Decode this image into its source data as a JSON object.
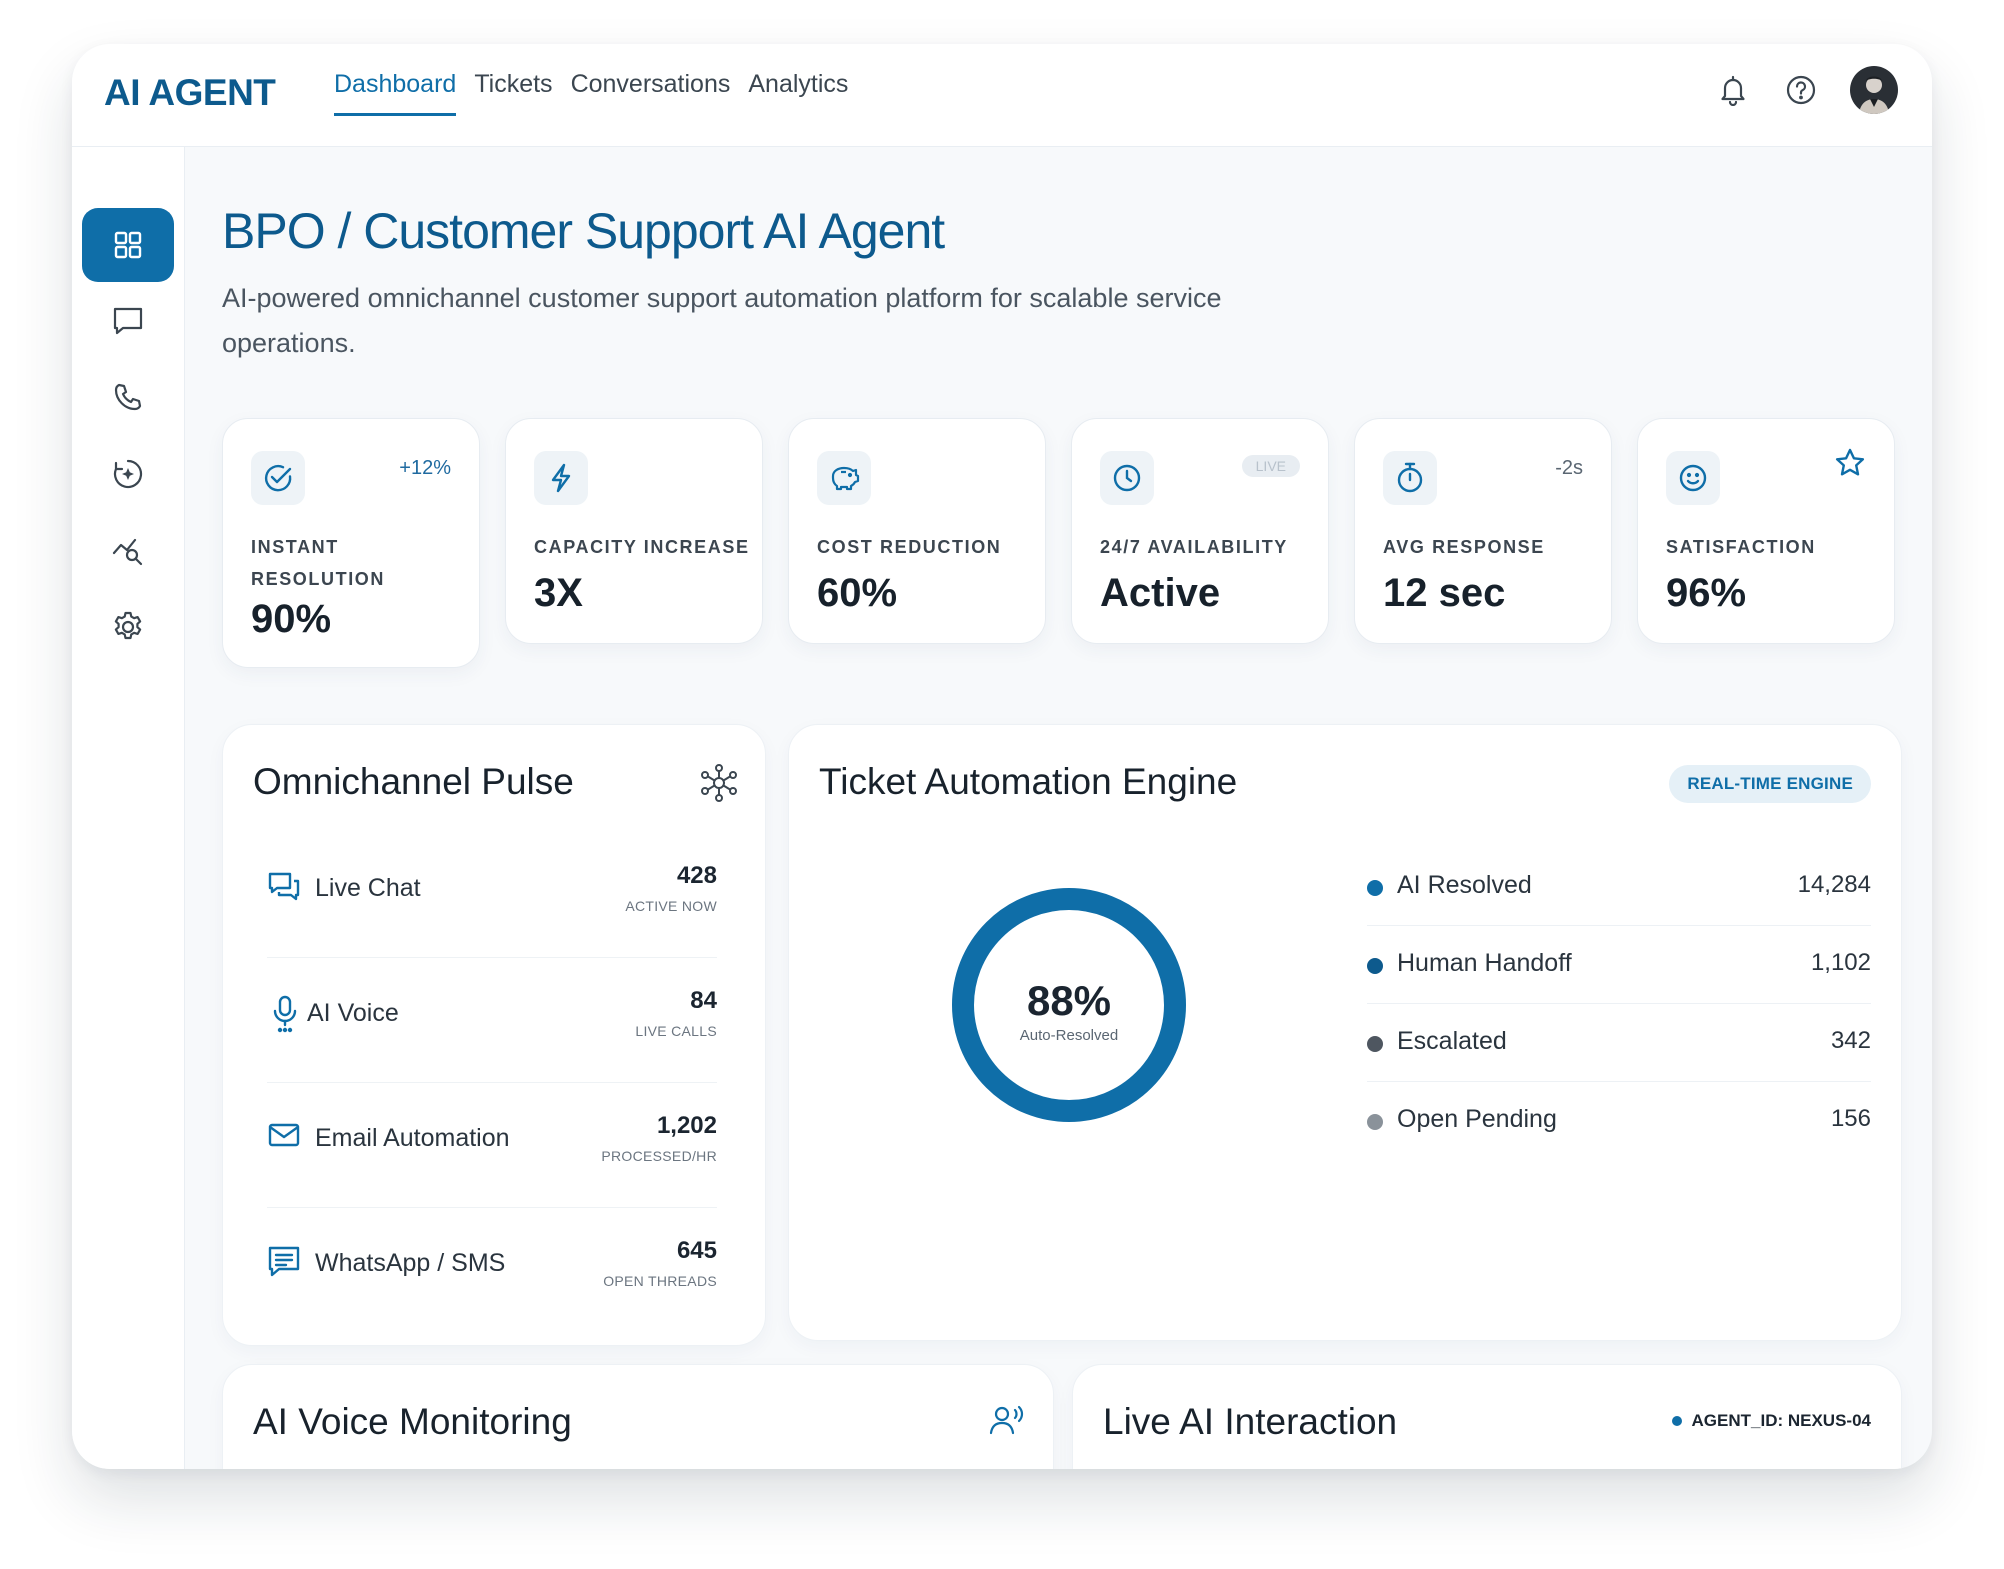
{
  "app": {
    "logo": "AI AGENT"
  },
  "nav": [
    "Dashboard",
    "Tickets",
    "Conversations",
    "Analytics"
  ],
  "nav_active": "Dashboard",
  "header": {
    "title": "BPO / Customer Support AI Agent",
    "subtitle": "AI-powered omnichannel customer support automation platform for scalable service operations."
  },
  "kpis": [
    {
      "label": "INSTANT RESOLUTION",
      "value": "90%",
      "badge": "+12%",
      "icon": "check-circle-icon"
    },
    {
      "label": "CAPACITY INCREASE",
      "value": "3X",
      "badge": "",
      "icon": "lightning-icon"
    },
    {
      "label": "COST REDUCTION",
      "value": "60%",
      "badge": "",
      "icon": "piggy-bank-icon"
    },
    {
      "label": "24/7 AVAILABILITY",
      "value": "Active",
      "badge": "LIVE",
      "icon": "clock-icon"
    },
    {
      "label": "AVG RESPONSE",
      "value": "12 sec",
      "badge": "-2s",
      "icon": "stopwatch-icon"
    },
    {
      "label": "SATISFACTION",
      "value": "96%",
      "badge": "",
      "icon": "smile-icon"
    }
  ],
  "pulse": {
    "title": "Omnichannel Pulse",
    "rows": [
      {
        "label": "Live Chat",
        "value": "428",
        "sub": "ACTIVE NOW",
        "icon": "chat-icon"
      },
      {
        "label": "AI Voice",
        "value": "84",
        "sub": "LIVE CALLS",
        "icon": "microphone-icon"
      },
      {
        "label": "Email Automation",
        "value": "1,202",
        "sub": "PROCESSED/HR",
        "icon": "mail-icon"
      },
      {
        "label": "WhatsApp / SMS",
        "value": "645",
        "sub": "OPEN THREADS",
        "icon": "message-icon"
      }
    ]
  },
  "engine": {
    "title": "Ticket Automation Engine",
    "badge": "REAL-TIME ENGINE",
    "donut_value": "88%",
    "donut_fraction": 1.0,
    "donut_label": "Auto-Resolved",
    "legend": [
      {
        "label": "AI Resolved",
        "value": "14,284",
        "color": "#0f6ea8"
      },
      {
        "label": "Human Handoff",
        "value": "1,102",
        "color": "#0d5a8d"
      },
      {
        "label": "Escalated",
        "value": "342",
        "color": "#4e5660"
      },
      {
        "label": "Open Pending",
        "value": "156",
        "color": "#8a929a"
      }
    ]
  },
  "voice": {
    "title": "AI Voice Monitoring"
  },
  "interaction": {
    "title": "Live AI Interaction",
    "agent_tag": "AGENT_ID: NEXUS-04"
  },
  "colors": {
    "accent": "#0f6ea8",
    "brand": "#0d5a8d"
  }
}
